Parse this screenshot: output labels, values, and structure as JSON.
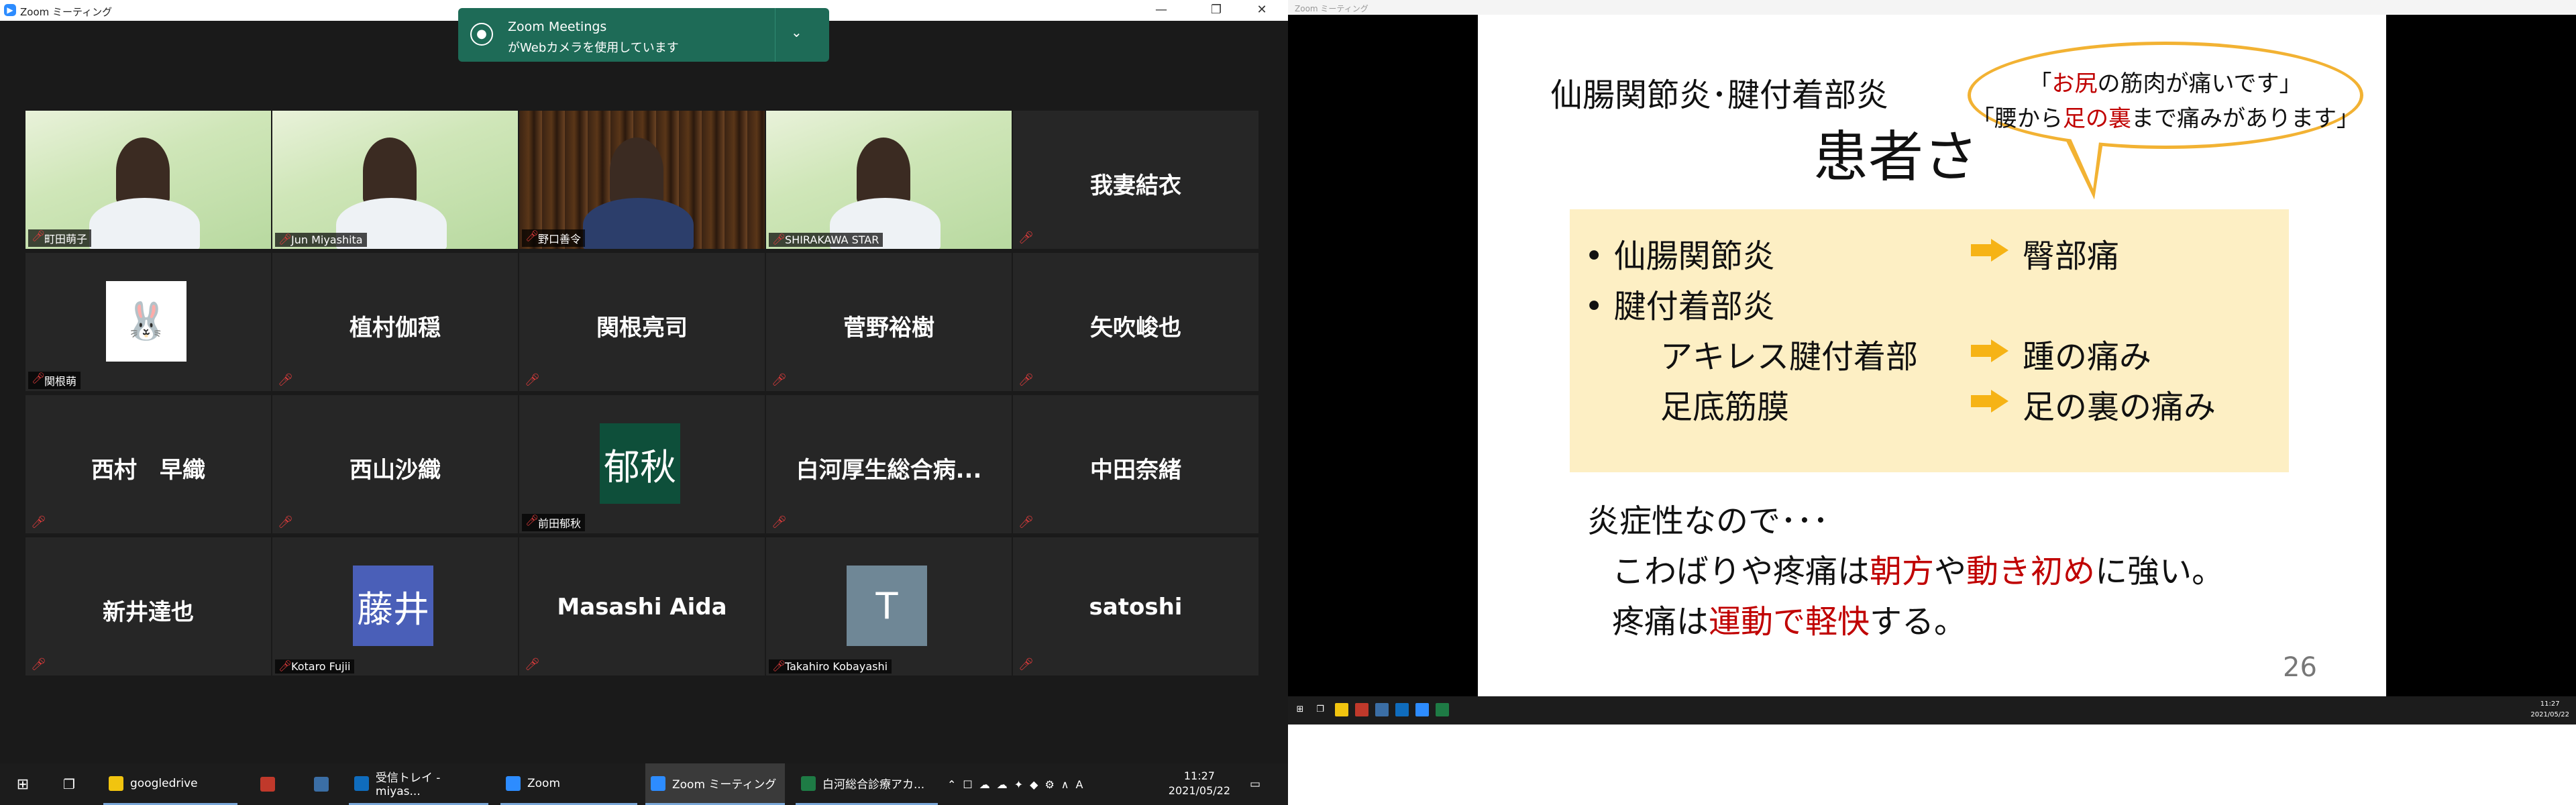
{
  "left_window": {
    "title": "Zoom ミーティング",
    "controls": {
      "minimize": "—",
      "restore": "❐",
      "close": "✕"
    }
  },
  "notification": {
    "title": "Zoom Meetings",
    "message": "がWebカメラを使用しています",
    "chevron": "⌄"
  },
  "participants": [
    {
      "name": "町田萌子",
      "kind": "video",
      "video": "green"
    },
    {
      "name": "Jun Miyashita",
      "kind": "video",
      "video": "green"
    },
    {
      "name": "野口善令",
      "kind": "video",
      "video": "books"
    },
    {
      "name": "SHIRAKAWA STAR",
      "kind": "video",
      "video": "green"
    },
    {
      "name": "我妻結衣",
      "kind": "name"
    },
    {
      "name": "関根萌",
      "kind": "avatar",
      "avatar_color": "#ffffff",
      "avatar_text": "🐰"
    },
    {
      "name": "植村伽穏",
      "kind": "name"
    },
    {
      "name": "関根亮司",
      "kind": "name"
    },
    {
      "name": "菅野裕樹",
      "kind": "name"
    },
    {
      "name": "矢吹峻也",
      "kind": "name"
    },
    {
      "name": "西村　早織",
      "kind": "name"
    },
    {
      "name": "西山沙織",
      "kind": "name"
    },
    {
      "name": "前田郁秋",
      "kind": "avatar",
      "avatar_color": "#0e4f3a",
      "avatar_text": "郁秋"
    },
    {
      "name": "白河厚生総合病...",
      "kind": "name"
    },
    {
      "name": "中田奈緒",
      "kind": "name"
    },
    {
      "name": "新井達也",
      "kind": "name"
    },
    {
      "name": "Kotaro Fujii",
      "kind": "avatar",
      "avatar_color": "#4a5fb8",
      "avatar_text": "藤井"
    },
    {
      "name": "Masashi Aida",
      "kind": "name"
    },
    {
      "name": "Takahiro Kobayashi",
      "kind": "avatar",
      "avatar_color": "#6f8796",
      "avatar_text": "T"
    },
    {
      "name": "satoshi",
      "kind": "name"
    }
  ],
  "taskbar": {
    "start_icon": "windows-icon",
    "items": [
      {
        "label": "googledrive",
        "icon_color": "#f1c40f",
        "state": "open"
      },
      {
        "label": "",
        "icon_color": "#c0392b",
        "state": "pinned"
      },
      {
        "label": "",
        "icon_color": "#3b6ea5",
        "state": "pinned"
      },
      {
        "label": "受信トレイ - miyas...",
        "icon_color": "#0f6cbd",
        "state": "open"
      },
      {
        "label": "Zoom",
        "icon_color": "#2d8cff",
        "state": "open"
      },
      {
        "label": "Zoom ミーティング",
        "icon_color": "#2d8cff",
        "state": "current"
      },
      {
        "label": "白河総合診療アカ...",
        "icon_color": "#1e7b45",
        "state": "open"
      }
    ],
    "time": "11:27",
    "date": "2021/05/22"
  },
  "slide": {
    "subtitle": "仙腸関節炎･腱付着部炎",
    "title": "患者さ",
    "bubble_line1": {
      "pre": "「",
      "red": "お尻",
      "post": "の筋肉が痛いです」"
    },
    "bubble_line2": {
      "pre": "「腰から",
      "red": "足の裏",
      "post": "まで痛みがあります」"
    },
    "box": {
      "rows": [
        {
          "left": "• 仙腸関節炎",
          "right": "臀部痛",
          "arrow": true
        },
        {
          "left": "• 腱付着部炎",
          "right": "",
          "arrow": false
        },
        {
          "left": "アキレス腱付着部",
          "right": "踵の痛み",
          "arrow": true
        },
        {
          "left": "足底筋膜",
          "right": "足の裏の痛み",
          "arrow": true
        }
      ]
    },
    "body_line1": "炎症性なので･･･",
    "body_line2": {
      "a": "こわばりや疼痛は",
      "b": "朝方",
      "c": "や",
      "d": "動き初め",
      "e": "に強い。"
    },
    "body_line3": {
      "a": "疼痛は",
      "b": "運動で軽快",
      "c": "する。"
    },
    "page_number": "26"
  },
  "right_taskbar": {
    "time": "11:27",
    "date": "2021/05/22"
  }
}
